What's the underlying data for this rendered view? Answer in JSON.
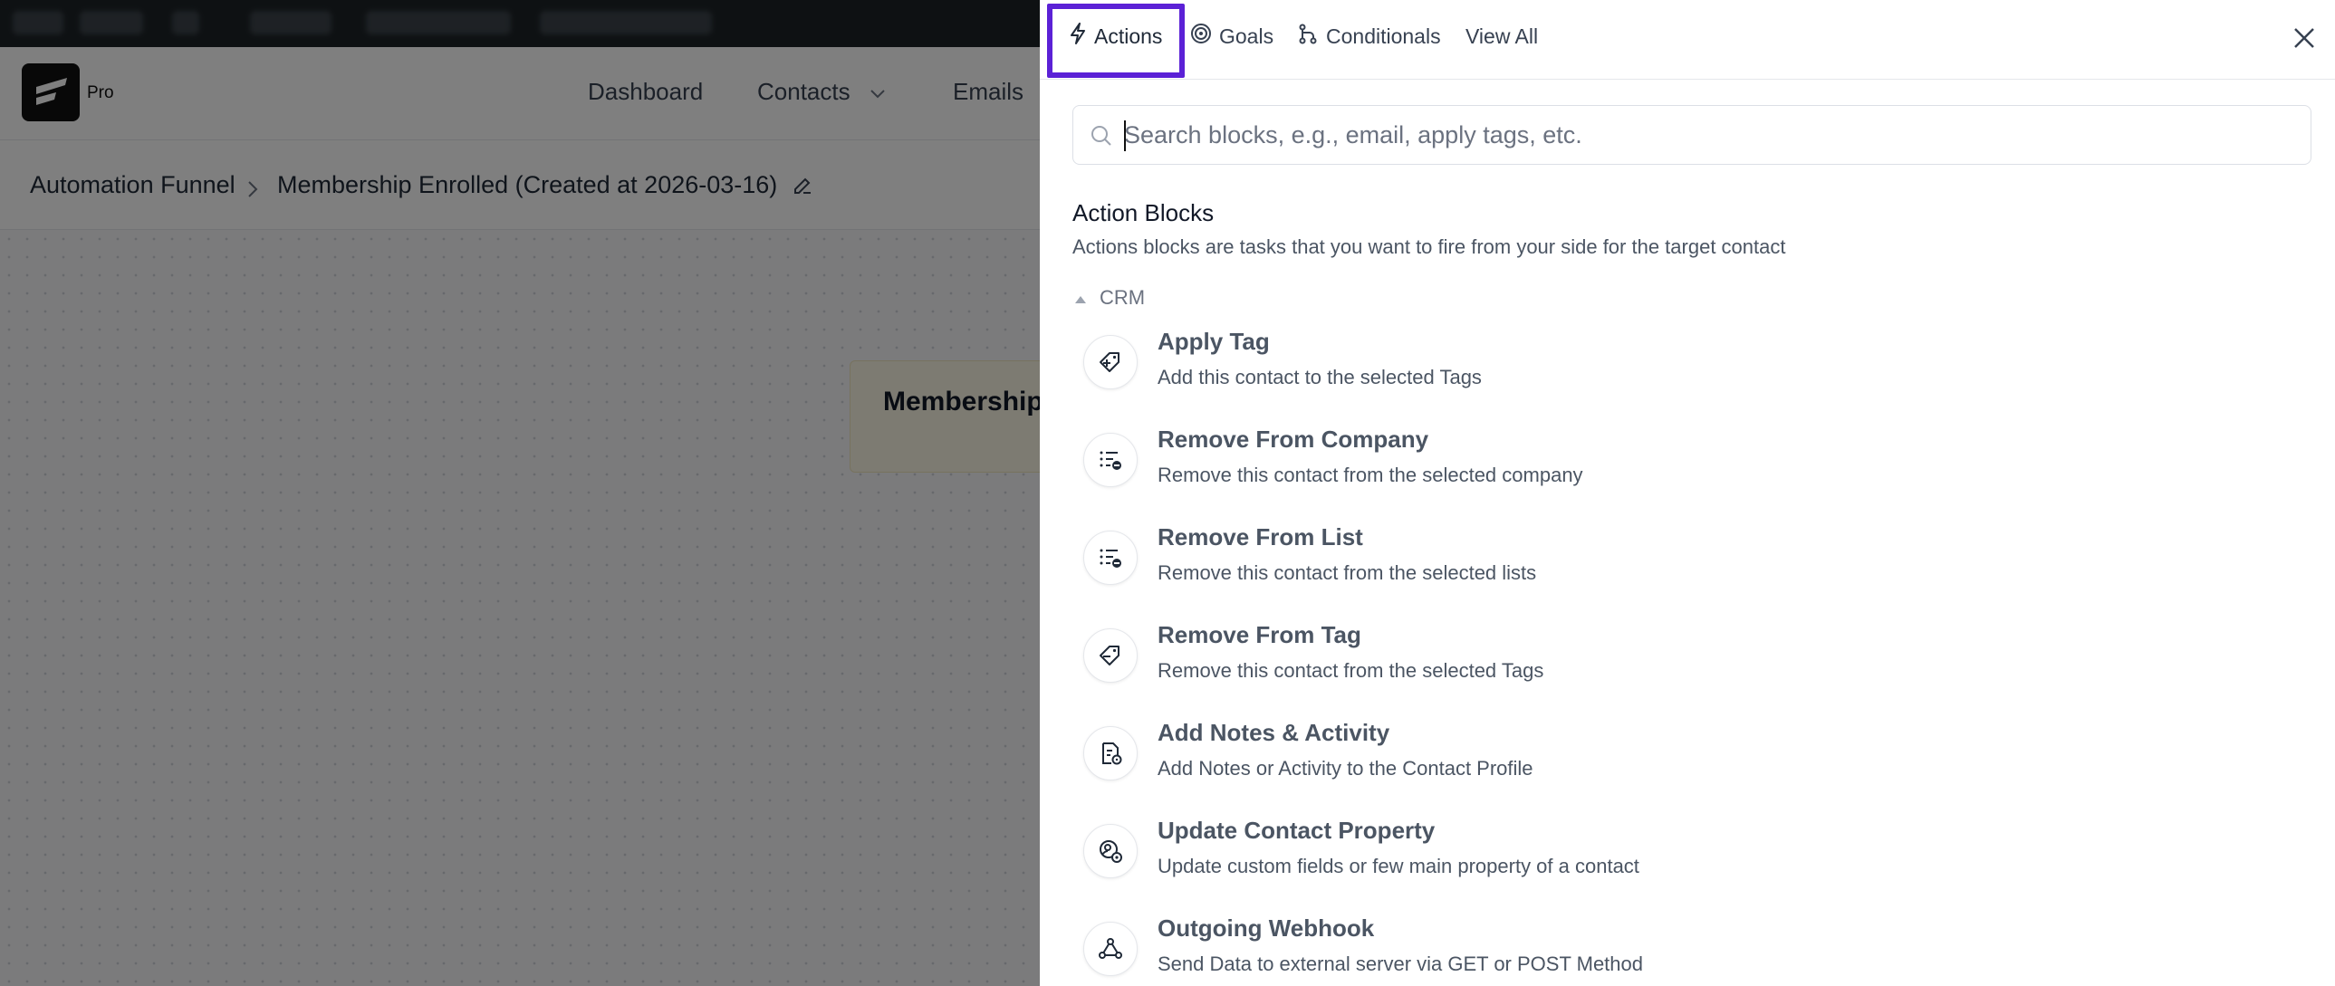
{
  "app": {
    "logo_badge": "Pro",
    "nav": [
      {
        "label": "Dashboard"
      },
      {
        "label": "Contacts"
      },
      {
        "label": "Emails"
      }
    ],
    "breadcrumb": {
      "root": "Automation Funnel",
      "current": "Membership Enrolled (Created at 2026-03-16)"
    },
    "canvas_trigger_label": "Membership"
  },
  "drawer": {
    "tabs": [
      {
        "label": "Actions",
        "icon": "bolt-icon",
        "active": true
      },
      {
        "label": "Goals",
        "icon": "target-icon",
        "active": false
      },
      {
        "label": "Conditionals",
        "icon": "branch-icon",
        "active": false
      },
      {
        "label": "View All",
        "icon": "",
        "active": false
      }
    ],
    "search_placeholder": "Search blocks, e.g., email, apply tags, etc.",
    "section_title": "Action Blocks",
    "section_desc": "Actions blocks are tasks that you want to fire from your side for the target contact",
    "group_label": "CRM",
    "blocks": [
      {
        "title": "Apply Tag",
        "desc": "Add this contact to the selected Tags",
        "icon": "tag-plus-icon"
      },
      {
        "title": "Remove From Company",
        "desc": "Remove this contact from the selected company",
        "icon": "list-remove-icon"
      },
      {
        "title": "Remove From List",
        "desc": "Remove this contact from the selected lists",
        "icon": "list-remove-icon"
      },
      {
        "title": "Remove From Tag",
        "desc": "Remove this contact from the selected Tags",
        "icon": "tag-remove-icon"
      },
      {
        "title": "Add Notes & Activity",
        "desc": "Add Notes or Activity to the Contact Profile",
        "icon": "note-icon"
      },
      {
        "title": "Update Contact Property",
        "desc": "Update custom fields or few main property of a contact",
        "icon": "contact-settings-icon"
      },
      {
        "title": "Outgoing Webhook",
        "desc": "Send Data to external server via GET or POST Method",
        "icon": "webhook-icon"
      }
    ],
    "accent_color": "#5b21d6"
  }
}
